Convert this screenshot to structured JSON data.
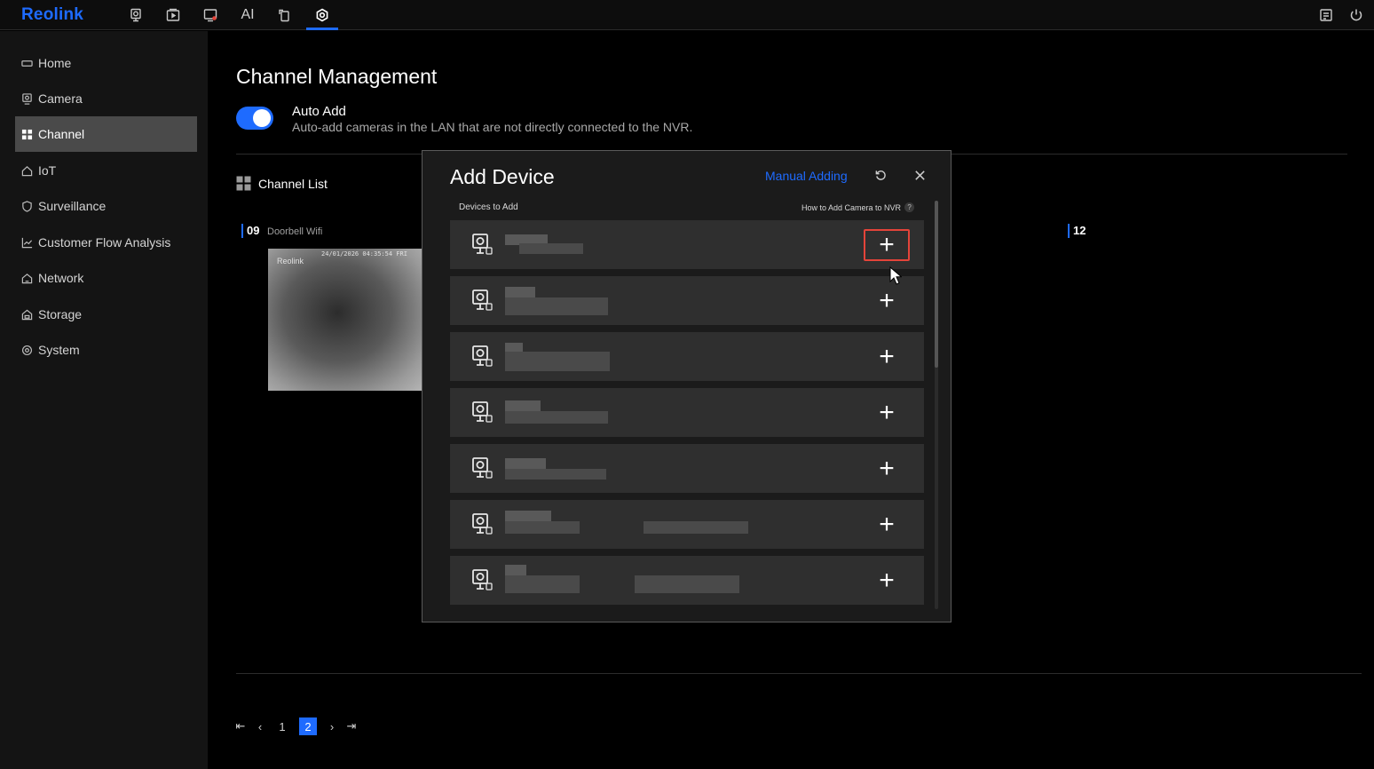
{
  "app": {
    "logo": "Reolink",
    "top_nav": [
      "camera-icon",
      "playback-icon",
      "alert-icon",
      "AI",
      "rotate-icon",
      "settings-icon"
    ],
    "top_nav_ai_label": "AI",
    "top_right": [
      "messages-icon",
      "power-icon"
    ],
    "accent_color": "#1e6bff"
  },
  "sidebar": {
    "items": [
      {
        "label": "Home",
        "icon": "home-icon"
      },
      {
        "label": "Camera",
        "icon": "camera-icon"
      },
      {
        "label": "Channel",
        "icon": "grid-icon",
        "active": true
      },
      {
        "label": "IoT",
        "icon": "house-icon"
      },
      {
        "label": "Surveillance",
        "icon": "shield-icon"
      },
      {
        "label": "Customer Flow Analysis",
        "icon": "chart-icon"
      },
      {
        "label": "Network",
        "icon": "network-icon"
      },
      {
        "label": "Storage",
        "icon": "storage-icon"
      },
      {
        "label": "System",
        "icon": "gear-icon"
      }
    ]
  },
  "main": {
    "title": "Channel Management",
    "auto_add": {
      "label": "Auto Add",
      "description": "Auto-add cameras in the LAN that are not directly connected to the NVR.",
      "enabled": true
    },
    "channel_list_title": "Channel List",
    "channels": [
      {
        "number": "09",
        "name": "Doorbell Wifi",
        "watermark": "Reolink",
        "timestamp": "24/01/2026 04:35:54 FRI"
      },
      {
        "number": "12",
        "name": ""
      }
    ],
    "pagination": {
      "first": "⇤",
      "prev": "‹",
      "pages": [
        "1",
        "2"
      ],
      "current": "2",
      "next": "›",
      "last": "⇥"
    }
  },
  "modal": {
    "title": "Add Device",
    "manual_adding": "Manual Adding",
    "devices_label": "Devices to Add",
    "howto": "How to Add Camera to NVR",
    "howto_icon": "?",
    "add_symbol": "+",
    "device_count": 7,
    "highlighted_row": 1
  }
}
